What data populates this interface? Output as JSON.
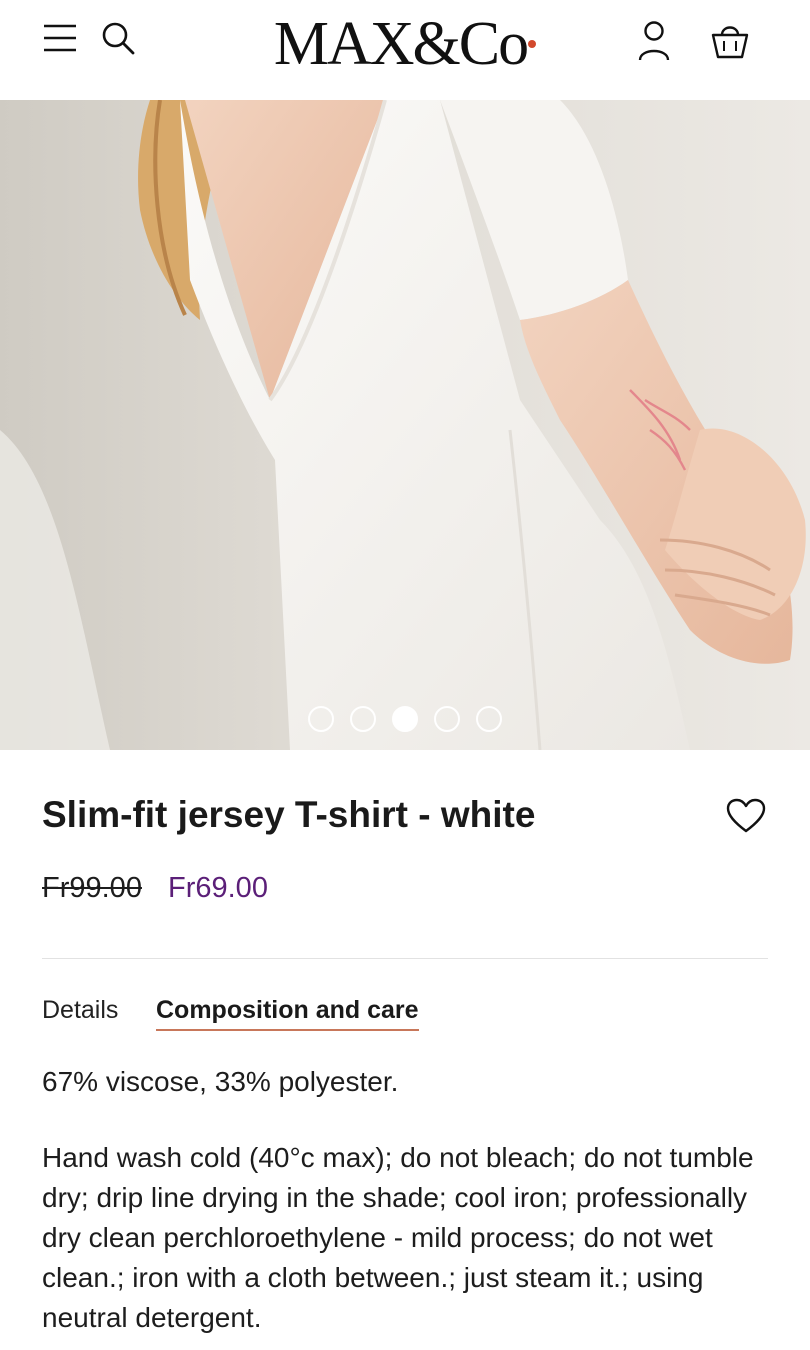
{
  "header": {
    "logo_text": "MAX&Co",
    "logo_dot_color": "#d2492c",
    "icons": {
      "menu": "hamburger-menu-icon",
      "search": "search-icon",
      "account": "user-icon",
      "bag": "shopping-bag-icon"
    }
  },
  "gallery": {
    "slide_count": 5,
    "active_slide": 3
  },
  "product": {
    "title": "Slim-fit jersey T-shirt - white",
    "price_original": "Fr99.00",
    "price_sale": "Fr69.00",
    "sale_color": "#5b1f78"
  },
  "tabs": {
    "details_label": "Details",
    "care_label": "Composition and care",
    "active": "care",
    "underline_color": "#c8775a"
  },
  "composition": {
    "materials": "67% viscose, 33% polyester.",
    "care_instructions": "Hand wash cold (40°c max); do not bleach; do not tumble dry; drip line drying in the shade; cool iron; professionally dry clean perchloroethylene - mild process; do not wet clean.; iron with a cloth between.; just steam it.; using neutral detergent."
  }
}
